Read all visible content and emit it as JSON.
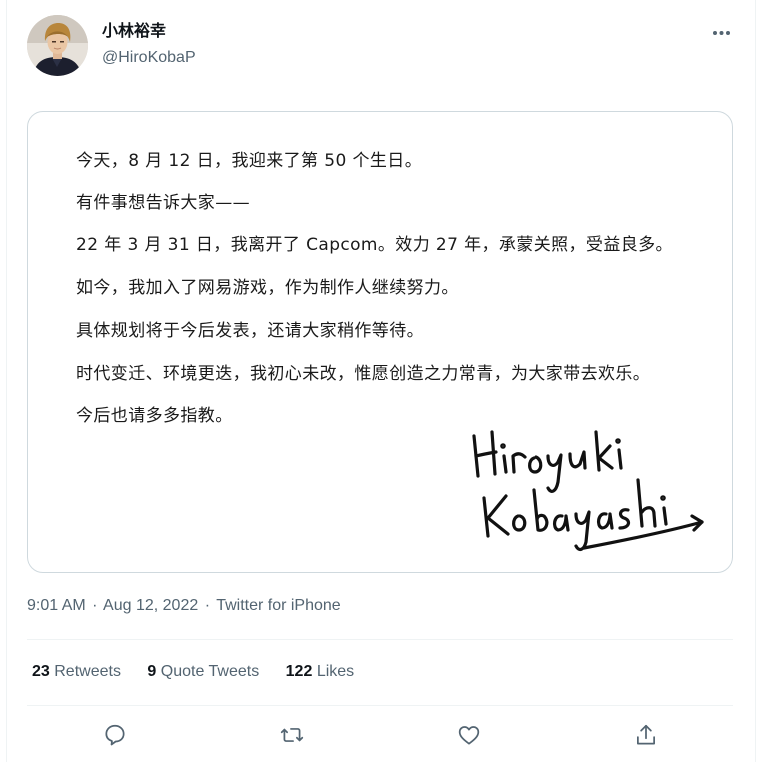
{
  "author": {
    "display_name": "小林裕幸",
    "handle": "@HiroKobaP"
  },
  "tweet_image": {
    "lines": [
      "今天，8 月 12 日，我迎来了第 50 个生日。",
      "有件事想告诉大家——",
      "22 年 3 月 31 日，我离开了 Capcom。效力 27 年，承蒙关照，受益良多。",
      "如今，我加入了网易游戏，作为制作人继续努力。",
      "具体规划将于今后发表，还请大家稍作等待。",
      "时代变迁、环境更迭，我初心未改，惟愿创造之力常青，为大家带去欢乐。",
      "今后也请多多指教。"
    ],
    "signature": [
      "Hiroyuki",
      "Kobayashi"
    ]
  },
  "meta": {
    "time": "9:01 AM",
    "date": "Aug 12, 2022",
    "source": "Twitter for iPhone",
    "separator": "·"
  },
  "stats": {
    "retweets_count": "23",
    "retweets_label": "Retweets",
    "quotes_count": "9",
    "quotes_label": "Quote Tweets",
    "likes_count": "122",
    "likes_label": "Likes"
  },
  "actions": [
    "reply-icon",
    "retweet-icon",
    "like-icon",
    "share-icon"
  ],
  "colors": {
    "text_primary": "#0f1419",
    "text_secondary": "#536471",
    "border": "#cfd9de",
    "divider": "#eff3f4"
  }
}
